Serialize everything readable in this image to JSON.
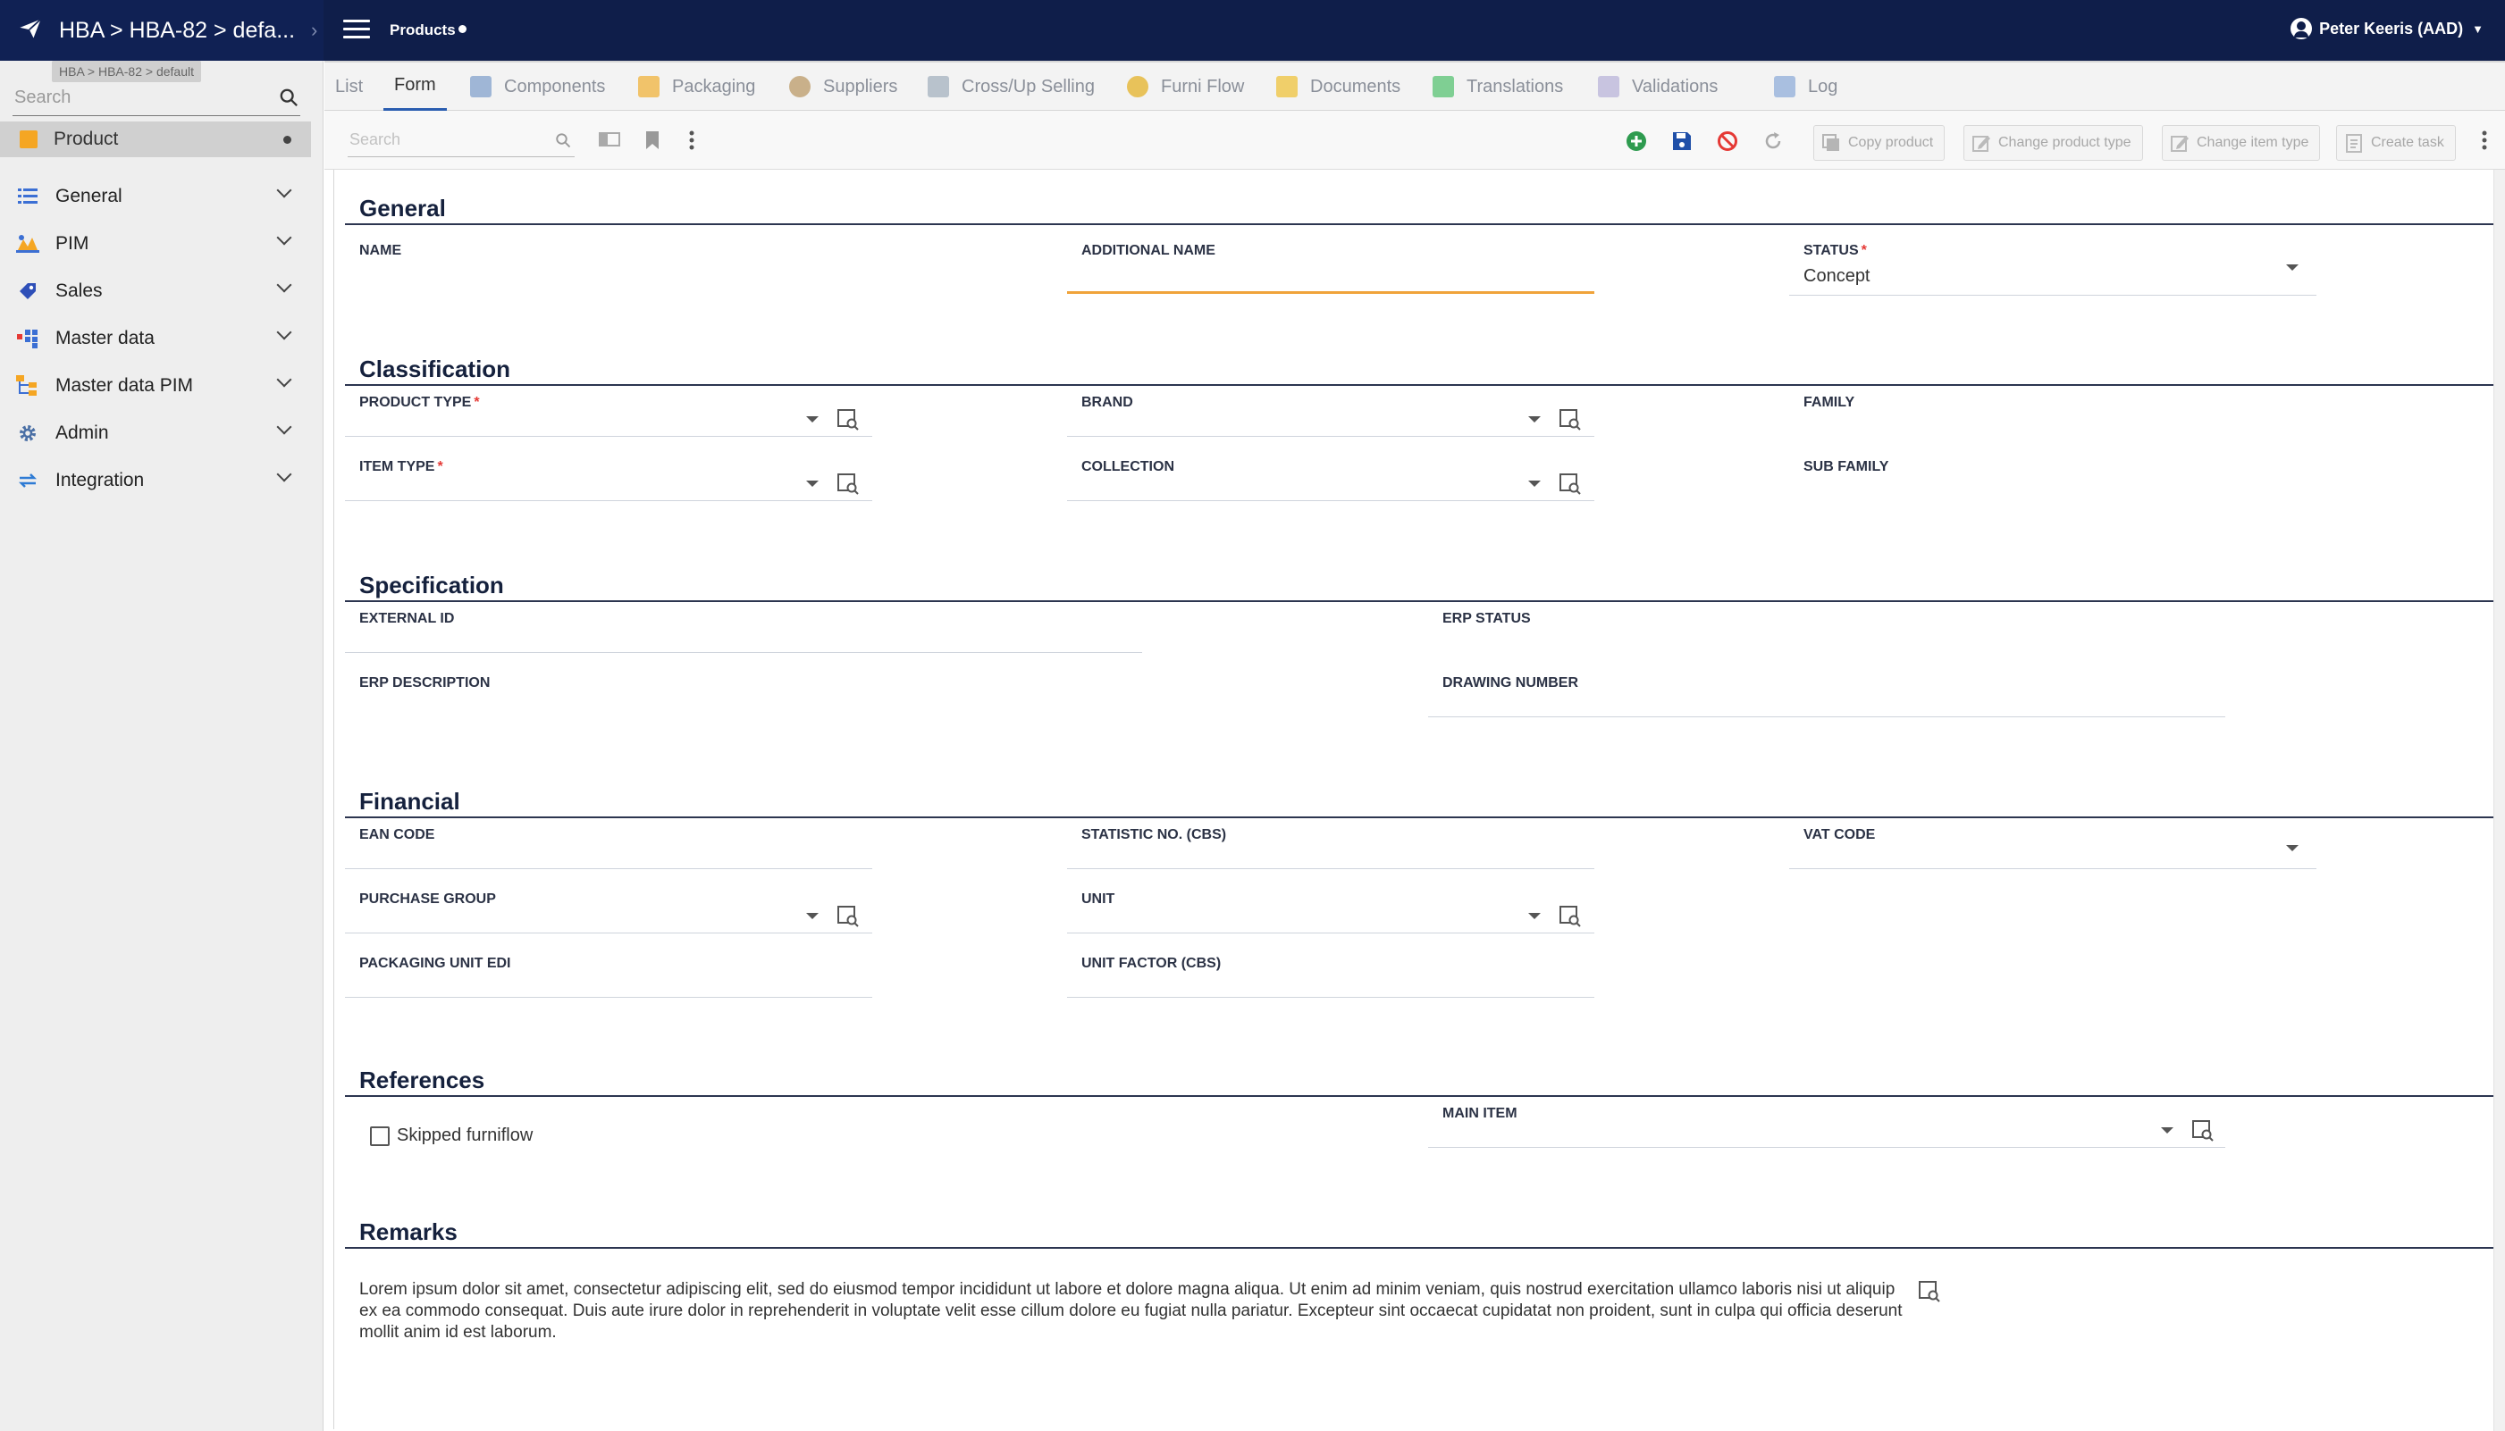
{
  "header": {
    "breadcrumb": "HBA > HBA-82 > defa...",
    "page_title": "Products",
    "user_name": "Peter Keeris (AAD)"
  },
  "sidebar": {
    "tooltip": "HBA > HBA-82 > default",
    "search_placeholder": "Search",
    "product_label": "Product",
    "items": [
      {
        "label": "General",
        "icon": "list-icon"
      },
      {
        "label": "PIM",
        "icon": "pim-icon"
      },
      {
        "label": "Sales",
        "icon": "tag-icon"
      },
      {
        "label": "Master data",
        "icon": "grid-icon"
      },
      {
        "label": "Master data PIM",
        "icon": "hierarchy-icon"
      },
      {
        "label": "Admin",
        "icon": "gear-icon"
      },
      {
        "label": "Integration",
        "icon": "sync-icon"
      }
    ]
  },
  "tabs": [
    {
      "label": "List"
    },
    {
      "label": "Form"
    },
    {
      "label": "Components"
    },
    {
      "label": "Packaging"
    },
    {
      "label": "Suppliers"
    },
    {
      "label": "Cross/Up Selling"
    },
    {
      "label": "Furni Flow"
    },
    {
      "label": "Documents"
    },
    {
      "label": "Translations"
    },
    {
      "label": "Validations"
    },
    {
      "label": "Log"
    }
  ],
  "toolbar": {
    "search_placeholder": "Search",
    "copy_product": "Copy product",
    "change_product_type": "Change product type",
    "change_item_type": "Change item type",
    "create_task": "Create task"
  },
  "form": {
    "general": {
      "title": "General",
      "name_label": "NAME",
      "additional_name_label": "ADDITIONAL NAME",
      "status_label": "STATUS",
      "status_value": "Concept"
    },
    "classification": {
      "title": "Classification",
      "product_type_label": "PRODUCT TYPE",
      "brand_label": "BRAND",
      "family_label": "FAMILY",
      "item_type_label": "ITEM TYPE",
      "collection_label": "COLLECTION",
      "sub_family_label": "SUB FAMILY"
    },
    "specification": {
      "title": "Specification",
      "external_id_label": "EXTERNAL ID",
      "erp_status_label": "ERP STATUS",
      "erp_description_label": "ERP DESCRIPTION",
      "drawing_number_label": "DRAWING NUMBER"
    },
    "financial": {
      "title": "Financial",
      "ean_code_label": "EAN CODE",
      "statistic_no_label": "STATISTIC NO. (CBS)",
      "vat_code_label": "VAT CODE",
      "purchase_group_label": "PURCHASE GROUP",
      "unit_label": "UNIT",
      "packaging_unit_edi_label": "PACKAGING UNIT EDI",
      "unit_factor_label": "UNIT FACTOR (CBS)"
    },
    "references": {
      "title": "References",
      "skipped_furniflow_label": "Skipped furniflow",
      "skipped_furniflow_checked": false,
      "main_item_label": "MAIN ITEM"
    },
    "remarks": {
      "title": "Remarks",
      "text": "Lorem ipsum dolor sit amet, consectetur adipiscing elit, sed do eiusmod tempor incididunt ut labore et dolore magna aliqua. Ut enim ad minim veniam, quis nostrud exercitation ullamco laboris nisi ut aliquip ex ea commodo consequat. Duis aute irure dolor in reprehenderit in voluptate velit esse cillum dolore eu fugiat nulla pariatur. Excepteur sint occaecat cupidatat non proident, sunt in culpa qui officia deserunt mollit anim id est laborum."
    }
  },
  "colors": {
    "header_bg": "#0f1e4a",
    "focus_underline": "#f0a33a",
    "required_star": "#e53935",
    "add_green": "#2e9b4f",
    "save_blue": "#1f4fa8",
    "cancel_red": "#e53935"
  }
}
